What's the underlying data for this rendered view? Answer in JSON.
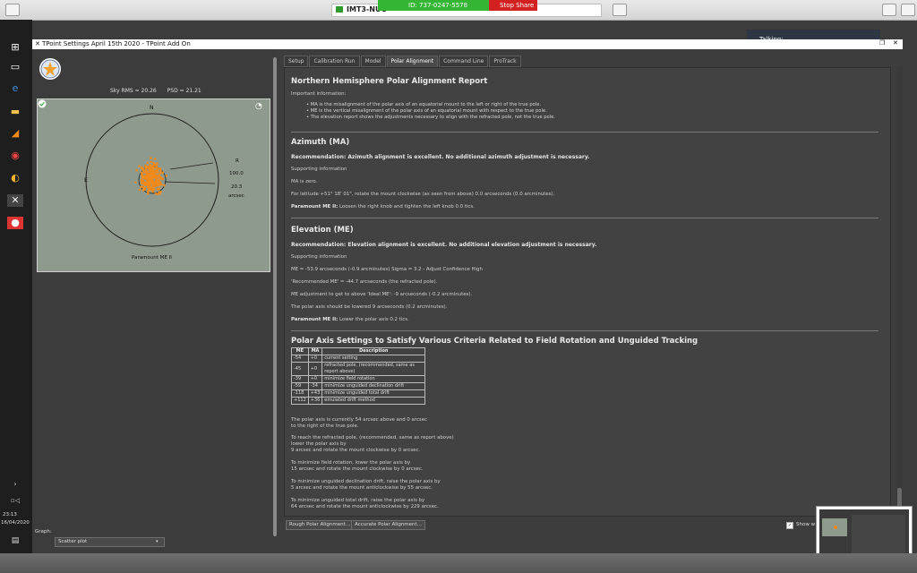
{
  "remote": {
    "host_name": "IMT3-NUC",
    "session_id": "ID: 737-0247-5578",
    "stop_share": "Stop Share",
    "talking": "Talking:"
  },
  "taskbar": {
    "clock_time": "23:13",
    "clock_date": "16/04/2020"
  },
  "window": {
    "title": "TPoint Settings April 15th 2020 - TPoint Add On"
  },
  "left": {
    "sky_rms_label": "Sky RMS =",
    "sky_rms_value": "20.26",
    "psd_label": "PSD =",
    "psd_value": "21.21",
    "compass_n": "N",
    "compass_e": "E",
    "scale_r": "R",
    "scale_outer": "100.0",
    "scale_inner": "20.3",
    "scale_unit": "arcsec",
    "mount_label": "Paramount ME II",
    "graph_label": "Graph:",
    "graph_value": "Scatter plot"
  },
  "tabs": [
    "Setup",
    "Calibration Run",
    "Model",
    "Polar Alignment",
    "Command Line",
    "ProTrack"
  ],
  "report": {
    "title": "Northern Hemisphere Polar Alignment Report",
    "important": "Important information:",
    "bullets": [
      "MA is the misalignment of the polar axis of an equatorial mount to the left or right of the true pole.",
      "ME is the vertical misalignment of the polar axis of an equatorial mount with respect to the true pole.",
      "The elevation report shows the adjustments necessary to align with the refracted pole, not the true pole."
    ],
    "az_heading": "Azimuth (MA)",
    "az_rec": "Recommendation: Azimuth alignment is excellent. No additional azimuth adjustment is necessary.",
    "az_support": "Supporting information",
    "az_zero": "MA is zero.",
    "az_lat": "For latitude +51° 18' 01\", rotate the mount clockwise (as seen from above) 0.0 arcseconds (0.0 arcminutes).",
    "az_pm_label": "Paramount ME II:",
    "az_pm_text": "Loosen the right knob and tighten the left knob 0.0 tics.",
    "el_heading": "Elevation (ME)",
    "el_rec": "Recommendation: Elevation alignment is excellent. No additional elevation adjustment is necessary.",
    "el_support": "Supporting information",
    "el_me": "ME = -53.9 arcseconds (-0.9 arcminutes) Sigma = 3.2 - Adjust Confidence High",
    "el_rec_me": "'Recommended ME' = -44.7 arcseconds (the refracted pole).",
    "el_adj": "ME adjustment to get to above 'Ideal ME': -9 arcseconds (-0.2 arcminutes).",
    "el_lower": "The polar axis should be lowered 9 arcseconds (0.2 arcminutes).",
    "el_pm_label": "Paramount ME II:",
    "el_pm_text": "Lower the polar axis 0.2 tics.",
    "pa_heading": "Polar Axis Settings to Satisfy Various Criteria Related to Field Rotation and Unguided Tracking",
    "table_headers": [
      "ME",
      "MA",
      "Description"
    ],
    "table_rows": [
      [
        "-54",
        "+0",
        "current setting"
      ],
      [
        "-45",
        "+0",
        "refracted pole, (recommended, same as report above)"
      ],
      [
        "-39",
        "+0",
        "minimize field rotation"
      ],
      [
        "-59",
        "-34",
        "minimize unguided declination drift"
      ],
      [
        "-118",
        "+43",
        "minimize unguided total drift"
      ],
      [
        "+112",
        "+36",
        "emulated drift method"
      ]
    ],
    "para1a": "The polar axis is currently 54 arcsec above and 0 arcsec",
    "para1b": "to the right of the true pole.",
    "para2a": "To reach the refracted pole, (recommended, same as report above)",
    "para2b": "lower the polar axis by",
    "para2c": "9 arcsec and rotate the mount clockwise by 0 arcsec.",
    "para3a": "To minimize field rotation, lower the polar axis by",
    "para3b": "15 arcsec and rotate the mount clockwise by 0 arcsec.",
    "para4a": "To minimize unguided declination drift, raise the polar axis by",
    "para4b": "5 arcsec and rotate the mount anticlockwise by 55 arcsec.",
    "para5a": "To minimize unguided total drift, raise the polar axis by",
    "para5b": "64 arcsec and rotate the mount anticlockwise by 229 arcsec."
  },
  "buttons": {
    "rough": "Rough Polar Alignment...",
    "accurate": "Accurate Polar Alignment...",
    "show_label": "Show w"
  },
  "colors": {
    "accent_orange": "#f08a1c",
    "plot_bg": "#8e9a8d",
    "stop_red": "#d32020",
    "session_green": "#35b534"
  }
}
